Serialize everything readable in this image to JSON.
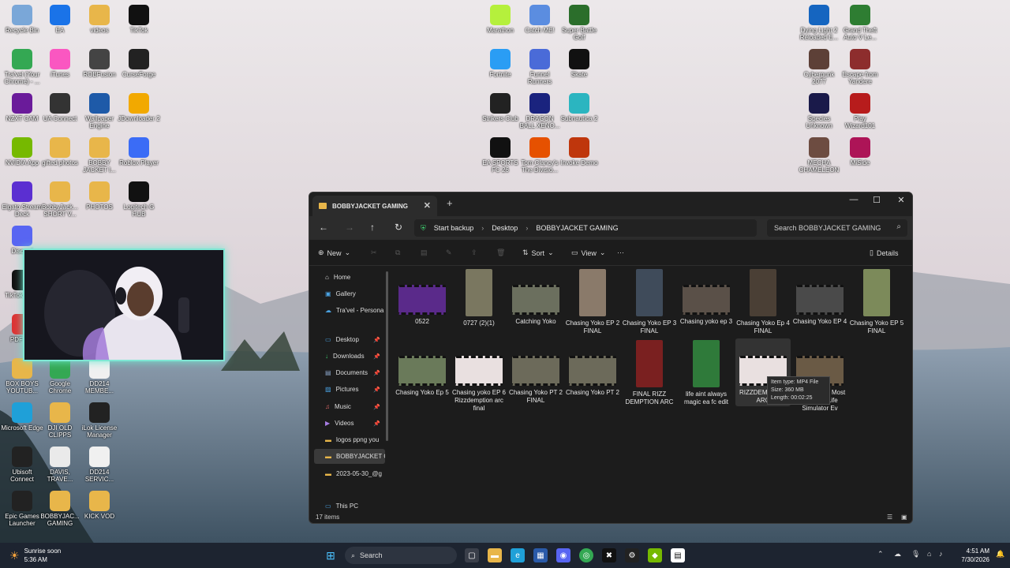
{
  "desktop": {
    "icons": [
      {
        "label": "Recycle Bin",
        "color": "#7aa7d8"
      },
      {
        "label": "EA",
        "color": "#1a73e8"
      },
      {
        "label": "videos",
        "color": "#e8b64a"
      },
      {
        "label": "TikTok",
        "color": "#111111"
      },
      {
        "label": "Tra'vel (Your Chrome) - ...",
        "color": "#34a853"
      },
      {
        "label": "iTunes",
        "color": "#fa57c1"
      },
      {
        "label": "ROBFusion",
        "color": "#444444"
      },
      {
        "label": "CurseForge",
        "color": "#222222"
      },
      {
        "label": "NZXT CAM",
        "color": "#6a1b9a"
      },
      {
        "label": "UA Connect",
        "color": "#333333"
      },
      {
        "label": "Wallpaper Engine",
        "color": "#1e5aa8"
      },
      {
        "label": "JDownloader 2",
        "color": "#f2a900"
      },
      {
        "label": "NVIDIA App",
        "color": "#76b900"
      },
      {
        "label": "gifted photos",
        "color": "#e8b64a"
      },
      {
        "label": "BOBBY JACKET I...",
        "color": "#e8b64a"
      },
      {
        "label": "Roblox Player",
        "color": "#3b6cf6"
      },
      {
        "label": "Elgato Stream Deck",
        "color": "#5b2fd1"
      },
      {
        "label": "BobbyJack... SHORT V...",
        "color": "#e8b64a"
      },
      {
        "label": "PHOTOS",
        "color": "#e8b64a"
      },
      {
        "label": "Logitech G HUB",
        "color": "#111111"
      },
      {
        "label": "Discord",
        "color": "#5865f2"
      },
      {
        "label": "TikTok Stu...",
        "color": "#111111"
      },
      {
        "label": "PDF S...",
        "color": "#d33"
      },
      {
        "label": "BOX BOYS YOUTUB...",
        "color": "#e8b64a"
      },
      {
        "label": "Google Chrome",
        "color": "#34a853"
      },
      {
        "label": "DD214 MEMBE...",
        "color": "#f0f0f0"
      },
      {
        "label": "Microsoft Edge",
        "color": "#1fa0d8"
      },
      {
        "label": "DJI OLD CLIPPS",
        "color": "#e8b64a"
      },
      {
        "label": "iLok License Manager",
        "color": "#222222"
      },
      {
        "label": "Ubisoft Connect",
        "color": "#222222"
      },
      {
        "label": "DAVIS, TRAVE...",
        "color": "#eaeaea"
      },
      {
        "label": "DD214 SERVIC...",
        "color": "#f0f0f0"
      },
      {
        "label": "Epic Games Launcher",
        "color": "#222222"
      },
      {
        "label": "BOBBYJAC... GAMING",
        "color": "#e8b64a"
      },
      {
        "label": "KICK VOD",
        "color": "#e8b64a"
      },
      {
        "label": "Marathon",
        "color": "#b5f03c"
      },
      {
        "label": "Catch ME!",
        "color": "#5b8de0"
      },
      {
        "label": "Super Battle Golf",
        "color": "#2b6e2b"
      },
      {
        "label": "Fortnite",
        "color": "#2a9df4"
      },
      {
        "label": "Funnel Runners",
        "color": "#4a6bd8"
      },
      {
        "label": "Skate",
        "color": "#111111"
      },
      {
        "label": "Strikers Club",
        "color": "#222222"
      },
      {
        "label": "DRAGON BALL XENO...",
        "color": "#1a237e"
      },
      {
        "label": "Subnautica 2",
        "color": "#2bb5c0"
      },
      {
        "label": "EA SPORTS FC 26",
        "color": "#111111"
      },
      {
        "label": "Tom Clancy's The Divisio...",
        "color": "#e65100"
      },
      {
        "label": "Invoke Demo",
        "color": "#bf360c"
      },
      {
        "label": "Dying Light 2 Reloaded E...",
        "color": "#1565c0"
      },
      {
        "label": "Grand Theft Auto V Le...",
        "color": "#2e7d32"
      },
      {
        "label": "Cyberpunk 2077",
        "color": "#5d4037"
      },
      {
        "label": "Escape from Yandere",
        "color": "#8d2d2d"
      },
      {
        "label": "Species Unknown",
        "color": "#1a1a4a"
      },
      {
        "label": "Play Wizard101",
        "color": "#b71c1c"
      },
      {
        "label": "MECHA CHAMELEON",
        "color": "#6d4c41"
      },
      {
        "label": "MiSide",
        "color": "#ad1457"
      }
    ]
  },
  "explorer": {
    "tab_title": "BOBBYJACKET GAMING",
    "new_tab": "+",
    "breadcrumb": [
      "Start backup",
      "Desktop",
      "BOBBYJACKET GAMING"
    ],
    "search_placeholder": "Search BOBBYJACKET GAMING",
    "commands": {
      "new": "New",
      "sort": "Sort",
      "view": "View",
      "more": "···",
      "details": "Details"
    },
    "sidebar": [
      {
        "label": "Home",
        "pinned": false
      },
      {
        "label": "Gallery",
        "pinned": false
      },
      {
        "label": "Tra'vel - Persona",
        "pinned": false
      },
      {
        "label": "Desktop",
        "pinned": true
      },
      {
        "label": "Downloads",
        "pinned": true
      },
      {
        "label": "Documents",
        "pinned": true
      },
      {
        "label": "Pictures",
        "pinned": true
      },
      {
        "label": "Music",
        "pinned": true
      },
      {
        "label": "Videos",
        "pinned": true
      },
      {
        "label": "logos ppng you",
        "pinned": false
      },
      {
        "label": "BOBBYJACKET G",
        "pinned": false
      },
      {
        "label": "2023-05-30_@g",
        "pinned": false
      },
      {
        "label": "This PC",
        "pinned": false
      }
    ],
    "files": [
      {
        "name": "0522",
        "shape": "wide",
        "color": "#5a2a8a"
      },
      {
        "name": "0727 (2)(1)",
        "shape": "tall",
        "color": "#7a7760"
      },
      {
        "name": "Catching Yoko",
        "shape": "wide",
        "color": "#6b6f5e"
      },
      {
        "name": "Chasing Yoko EP 2 FINAL",
        "shape": "tall",
        "color": "#8a7a6a"
      },
      {
        "name": "Chasing Yoko EP 3 FINAL",
        "shape": "tall",
        "color": "#3f4b5a"
      },
      {
        "name": "Chasing yoko ep 3",
        "shape": "wide",
        "color": "#5a5048"
      },
      {
        "name": "Chasing Yoko Ep 4 FINAL",
        "shape": "tall",
        "color": "#4a3f35"
      },
      {
        "name": "Chasing Yoko EP 4",
        "shape": "wide",
        "color": "#4a4a4a"
      },
      {
        "name": "Chasing Yoko EP 5 FINAL",
        "shape": "tall",
        "color": "#7c8a5a"
      },
      {
        "name": "Chasing Yoko Ep 5",
        "shape": "wide",
        "color": "#6a7a5a"
      },
      {
        "name": "Chasing yoko EP 6 Rizzdemption arc final",
        "shape": "wide",
        "color": "#e9e0e0"
      },
      {
        "name": "Chasing Yoko PT 2 FINAL",
        "shape": "wide",
        "color": "#6c6a5a"
      },
      {
        "name": "Chasing Yoko PT 2",
        "shape": "wide",
        "color": "#6c6a5a"
      },
      {
        "name": "FINAL RIZZ DEMPTION ARC",
        "shape": "tall",
        "color": "#7a2020"
      },
      {
        "name": "life aint always magic ea fc edit",
        "shape": "tall",
        "color": "#2f7a3a"
      },
      {
        "name": "RIZZDEMPTION ARC",
        "shape": "wide",
        "color": "#e9e0e0"
      },
      {
        "name": "Might Be the Most Realistic Life Simulator Ev",
        "shape": "wide",
        "color": "#6a5a45"
      }
    ],
    "tooltip": {
      "type": "Item type: MP4 File",
      "size": "Size: 360 MB",
      "length": "Length: 00:02:25"
    },
    "status": "17 items"
  },
  "taskbar": {
    "weather_title": "Sunrise soon",
    "weather_time": "5:36 AM",
    "search_label": "Search",
    "time": "4:51 AM",
    "date": "7/30/2026"
  }
}
